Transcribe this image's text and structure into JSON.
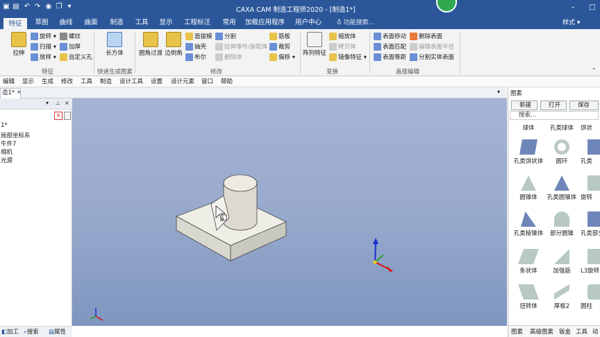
{
  "window": {
    "title": "CAXA CAM 制造工程师2020 - [制造1*]"
  },
  "quick_access": [
    "save-icon",
    "print-icon",
    "undo-icon",
    "redo-icon",
    "settings-icon",
    "copy-icon",
    "dropdown-icon"
  ],
  "tabs": [
    {
      "label": "特征",
      "active": true
    },
    {
      "label": "草图"
    },
    {
      "label": "曲线"
    },
    {
      "label": "曲面"
    },
    {
      "label": "制造"
    },
    {
      "label": "工具"
    },
    {
      "label": "显示"
    },
    {
      "label": "工程标注"
    },
    {
      "label": "常用"
    },
    {
      "label": "加载应用程序"
    },
    {
      "label": "用户中心"
    }
  ],
  "search": {
    "placeholder": "功能搜索..."
  },
  "style_label": "样式",
  "ribbon": {
    "groups": [
      {
        "label": "特征"
      },
      {
        "label": "快速生成图素"
      },
      {
        "label": "修改"
      },
      {
        "label": "变换"
      },
      {
        "label": "直接编辑"
      }
    ],
    "big": {
      "extrude": "拉伸",
      "cuboid": "长方体",
      "fillet": "圆角过渡",
      "chamfer": "边倒角",
      "pattern": "阵列特征"
    },
    "small": {
      "revolve": "旋转",
      "sweep": "扫描",
      "loft": "放样",
      "thread": "螺纹",
      "thicken": "加厚",
      "custom_hole": "自定义孔",
      "draft": "面拔模",
      "shell": "抽壳",
      "boolean": "布尔",
      "split": "分割",
      "extrude_to_part": "拉伸零件/装配体",
      "delete_body": "删除体",
      "rib": "筋板",
      "trim": "裁剪",
      "offset": "偏移",
      "scale": "缩放体",
      "copy_body": "拷贝体",
      "mirror_feature": "镜像特征",
      "move_face": "表面移动",
      "match_face": "表面匹配",
      "face_distance": "表面等距",
      "delete_face": "删除表面",
      "edit_radius": "编辑表面半径",
      "separate": "分割实体表面"
    }
  },
  "menubar": [
    "编辑",
    "显示",
    "生成",
    "修改",
    "工具",
    "制造",
    "设计工具",
    "设置",
    "设计元素",
    "窗口",
    "帮助"
  ],
  "doc_tab": "造1*",
  "tree": [
    "1*",
    "局部坐标系",
    "牛件7",
    "相机",
    "光源"
  ],
  "left_status": [
    "加工",
    "搜索",
    "属性"
  ],
  "design_library": {
    "title": "图素",
    "buttons": [
      "新建",
      "打开",
      "保存"
    ],
    "search_placeholder": "搜索...",
    "items": [
      "球体",
      "孔类球体",
      "饼状",
      "孔类饼状体",
      "圆环",
      "孔类",
      "圆锥体",
      "孔类圆锥体",
      "旋转",
      "孔类棱锥体",
      "部分圆锥",
      "孔类部分圆锥",
      "条状体",
      "加强筋",
      "L3旋转",
      "扭转体",
      "厚板2",
      "圆柱"
    ],
    "bottom_tabs": [
      "图素",
      "高级图素",
      "钣金",
      "工具",
      "动"
    ]
  }
}
